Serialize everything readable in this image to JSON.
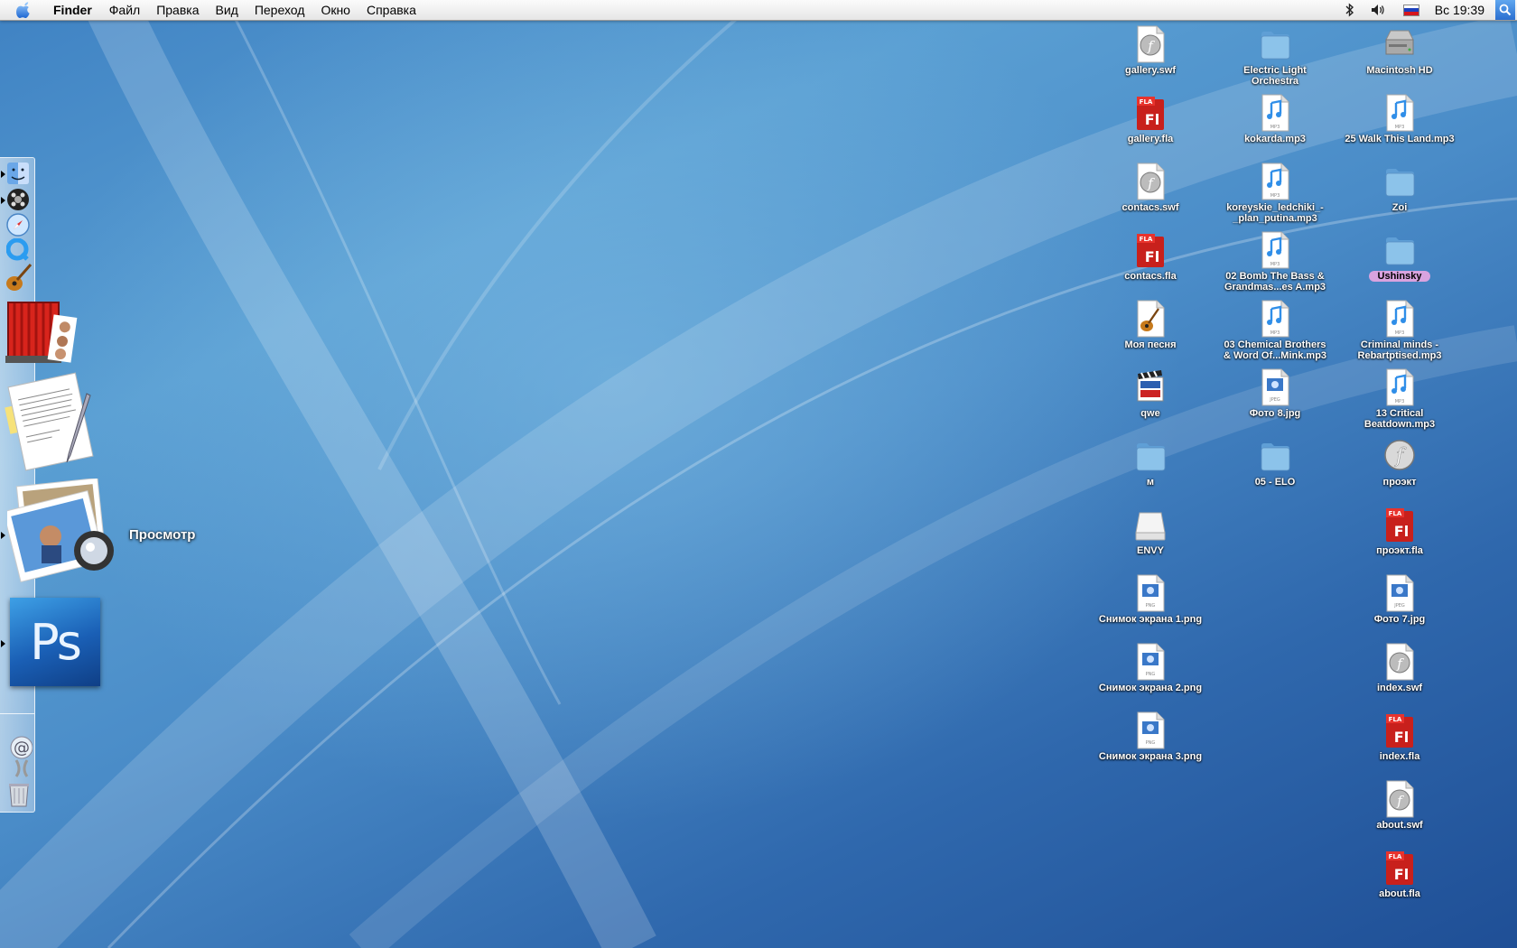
{
  "menubar": {
    "app_name": "Finder",
    "items": [
      "Файл",
      "Правка",
      "Вид",
      "Переход",
      "Окно",
      "Справка"
    ],
    "clock": "Вс 19:39"
  },
  "dock": {
    "hover_label": "Просмотр",
    "apps": [
      {
        "name": "Finder",
        "icon": "finder-icon"
      },
      {
        "name": "DVD Player",
        "icon": "dvd-player-icon"
      },
      {
        "name": "Safari",
        "icon": "safari-icon"
      },
      {
        "name": "QuickTime Player",
        "icon": "quicktime-icon"
      },
      {
        "name": "GarageBand",
        "icon": "garageband-icon"
      },
      {
        "name": "Front Row",
        "icon": "front-row-icon"
      },
      {
        "name": "TextEdit",
        "icon": "textedit-icon"
      },
      {
        "name": "Preview",
        "icon": "preview-icon"
      },
      {
        "name": "Photoshop",
        "icon": "photoshop-icon",
        "text": "Ps"
      },
      {
        "name": "Mail",
        "icon": "mail-icon"
      },
      {
        "name": "Trash",
        "icon": "trash-icon"
      }
    ]
  },
  "desktop": {
    "columns": [
      [
        {
          "label": "gallery.swf",
          "type": "swf"
        },
        {
          "label": "gallery.fla",
          "type": "fla"
        },
        {
          "label": "contacs.swf",
          "type": "swf"
        },
        {
          "label": "contacs.fla",
          "type": "fla"
        },
        {
          "label": "Моя песня",
          "type": "garageband"
        },
        {
          "label": "qwe",
          "type": "movie"
        },
        {
          "label": "м",
          "type": "folder"
        },
        {
          "label": "ENVY",
          "type": "drive"
        },
        {
          "label": "Снимок экрана 1.png",
          "type": "png"
        },
        {
          "label": "Снимок экрана 2.png",
          "type": "png"
        },
        {
          "label": "Снимок экрана 3.png",
          "type": "png"
        }
      ],
      [
        {
          "label": "Electric Light Orchestra",
          "type": "folder"
        },
        {
          "label": "kokarda.mp3",
          "type": "mp3"
        },
        {
          "label": "koreyskie_ledchiki_-_plan_putina.mp3",
          "type": "mp3"
        },
        {
          "label": "02 Bomb The Bass & Grandmas...es A.mp3",
          "type": "mp3"
        },
        {
          "label": "03 Chemical Brothers & Word Of...Mink.mp3",
          "type": "mp3"
        },
        {
          "label": "Фото 8.jpg",
          "type": "jpg"
        },
        {
          "label": "05 - ELO",
          "type": "folder"
        }
      ],
      [
        {
          "label": "Macintosh HD",
          "type": "hd"
        },
        {
          "label": "25 Walk This Land.mp3",
          "type": "mp3"
        },
        {
          "label": "Zoi",
          "type": "folder"
        },
        {
          "label": "Ushinsky",
          "type": "folder",
          "tagged": true
        },
        {
          "label": "Criminal minds - Rebartptised.mp3",
          "type": "mp3"
        },
        {
          "label": "13 Critical Beatdown.mp3",
          "type": "mp3"
        },
        {
          "label": "проэкт",
          "type": "flash-app"
        },
        {
          "label": "проэкт.fla",
          "type": "fla"
        },
        {
          "label": "Фото 7.jpg",
          "type": "jpg"
        },
        {
          "label": "index.swf",
          "type": "swf"
        },
        {
          "label": "index.fla",
          "type": "fla"
        },
        {
          "label": "about.swf",
          "type": "swf"
        },
        {
          "label": "about.fla",
          "type": "fla"
        }
      ]
    ]
  },
  "colors": {
    "fla_red": "#c8201c",
    "folder_blue": "#8cc3ea",
    "tag_purple": "#d9a3df"
  },
  "icon_text": {
    "fla_badge": "FLA",
    "fl": "Fl",
    "mp3_badge": "MP3",
    "png_badge": "PNG",
    "jpeg_badge": "JPEG",
    "swf_glyph": "f"
  }
}
